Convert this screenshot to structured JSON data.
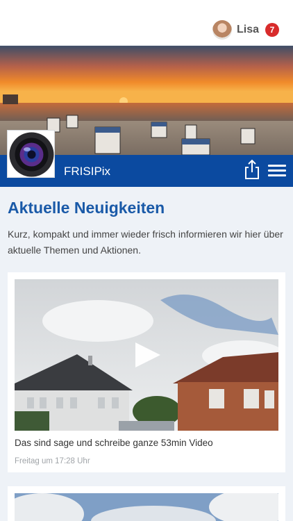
{
  "user": {
    "name": "Lisa",
    "notification_count": "7"
  },
  "app": {
    "title": "FRISIPix"
  },
  "news": {
    "heading": "Aktuelle Neuigkeiten",
    "intro": "Kurz, kompakt und immer wieder frisch informieren wir hier über aktuelle Themen und Aktionen."
  },
  "posts": [
    {
      "title": "Das sind sage und schreibe ganze 53min Video",
      "time": "Freitag um 17:28 Uhr",
      "has_video": true
    },
    {
      "title": "",
      "time": "",
      "has_video": false
    }
  ],
  "icons": {
    "share": "share-icon",
    "menu": "hamburger-menu-icon",
    "play": "play-icon",
    "logo": "camera-lens-icon"
  },
  "colors": {
    "brand_blue": "#0b4aa0",
    "heading_blue": "#1a5aa8",
    "badge_red": "#d82b2b"
  }
}
